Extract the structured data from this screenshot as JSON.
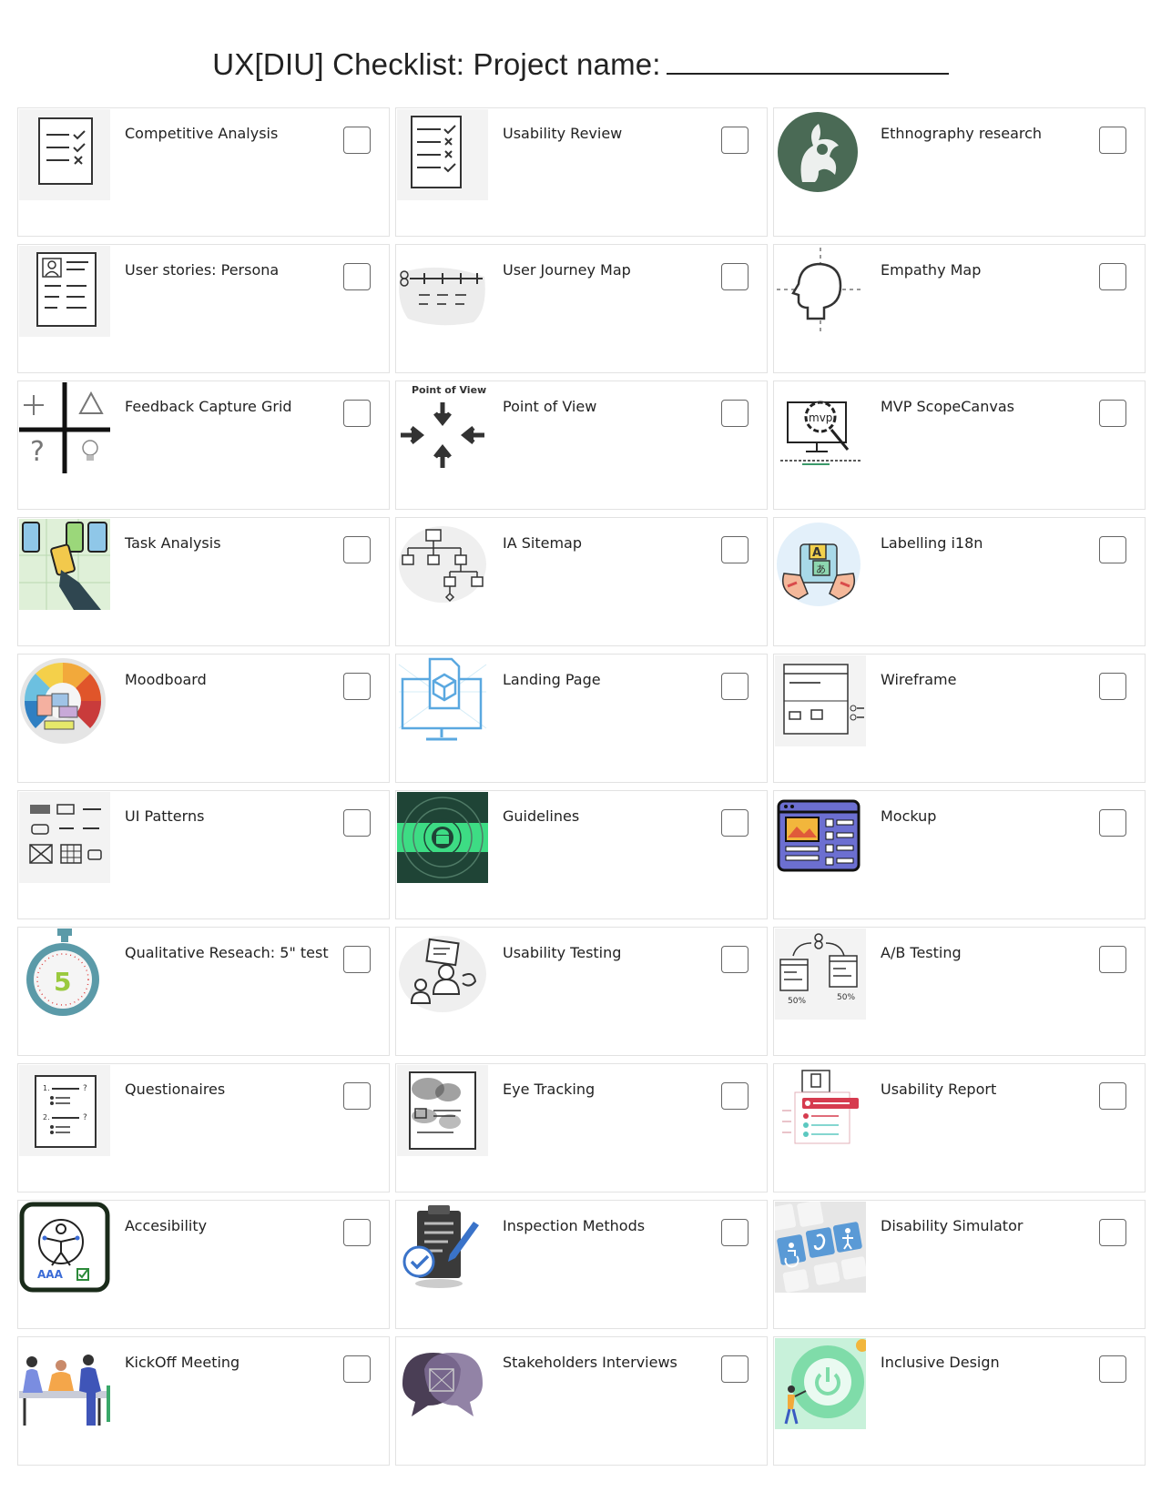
{
  "title": "UX[DIU] Checklist: Project name:",
  "items": [
    {
      "label": "Competitive Analysis",
      "icon": "checklist-icon"
    },
    {
      "label": "Usability Review",
      "icon": "review-checklist-icon"
    },
    {
      "label": "Ethnography research",
      "icon": "ethnography-icon"
    },
    {
      "label": "User stories: Persona",
      "icon": "persona-icon"
    },
    {
      "label": "User Journey Map",
      "icon": "journey-map-icon"
    },
    {
      "label": "Empathy Map",
      "icon": "head-icon"
    },
    {
      "label": "Feedback Capture Grid",
      "icon": "feedback-grid-icon"
    },
    {
      "label": "Point of View",
      "icon": "point-of-view-icon",
      "caption": "Point of View"
    },
    {
      "label": "MVP ScopeCanvas",
      "icon": "mvp-gear-icon",
      "caption": "mvp"
    },
    {
      "label": "Task Analysis",
      "icon": "task-analysis-icon"
    },
    {
      "label": "IA Sitemap",
      "icon": "sitemap-icon"
    },
    {
      "label": "Labelling i18n",
      "icon": "translation-icon"
    },
    {
      "label": "Moodboard",
      "icon": "color-wheel-icon"
    },
    {
      "label": "Landing Page",
      "icon": "monitor-cube-icon"
    },
    {
      "label": "Wireframe",
      "icon": "wireframe-icon"
    },
    {
      "label": "UI Patterns",
      "icon": "ui-patterns-icon"
    },
    {
      "label": "Guidelines",
      "icon": "android-guidelines-icon"
    },
    {
      "label": "Mockup",
      "icon": "mockup-window-icon"
    },
    {
      "label": "Qualitative Reseach: 5\" test",
      "icon": "stopwatch-icon",
      "caption": "5"
    },
    {
      "label": "Usability Testing",
      "icon": "usability-testing-icon"
    },
    {
      "label": "A/B Testing",
      "icon": "ab-testing-icon"
    },
    {
      "label": "Questionaires",
      "icon": "questionnaire-icon"
    },
    {
      "label": "Eye Tracking",
      "icon": "heatmap-icon"
    },
    {
      "label": "Usability Report",
      "icon": "report-icon"
    },
    {
      "label": "Accesibility",
      "icon": "accessibility-icon",
      "caption": "AAA"
    },
    {
      "label": "Inspection Methods",
      "icon": "clipboard-check-icon"
    },
    {
      "label": "Disability Simulator",
      "icon": "accessibility-keys-icon"
    },
    {
      "label": "KickOff Meeting",
      "icon": "meeting-people-icon"
    },
    {
      "label": "Stakeholders Interviews",
      "icon": "speech-bubbles-icon"
    },
    {
      "label": "Inclusive Design",
      "icon": "power-button-icon"
    }
  ],
  "colors": {
    "dark_green": "#4a6a55",
    "accent_blue": "#5aa8e0",
    "guideline_green": "#3ddc84",
    "mockup_purple": "#6c6fd1",
    "report_red": "#d63b4f",
    "stopwatch_teal": "#5b9aa8",
    "inclusive_green": "#7fdca9"
  }
}
